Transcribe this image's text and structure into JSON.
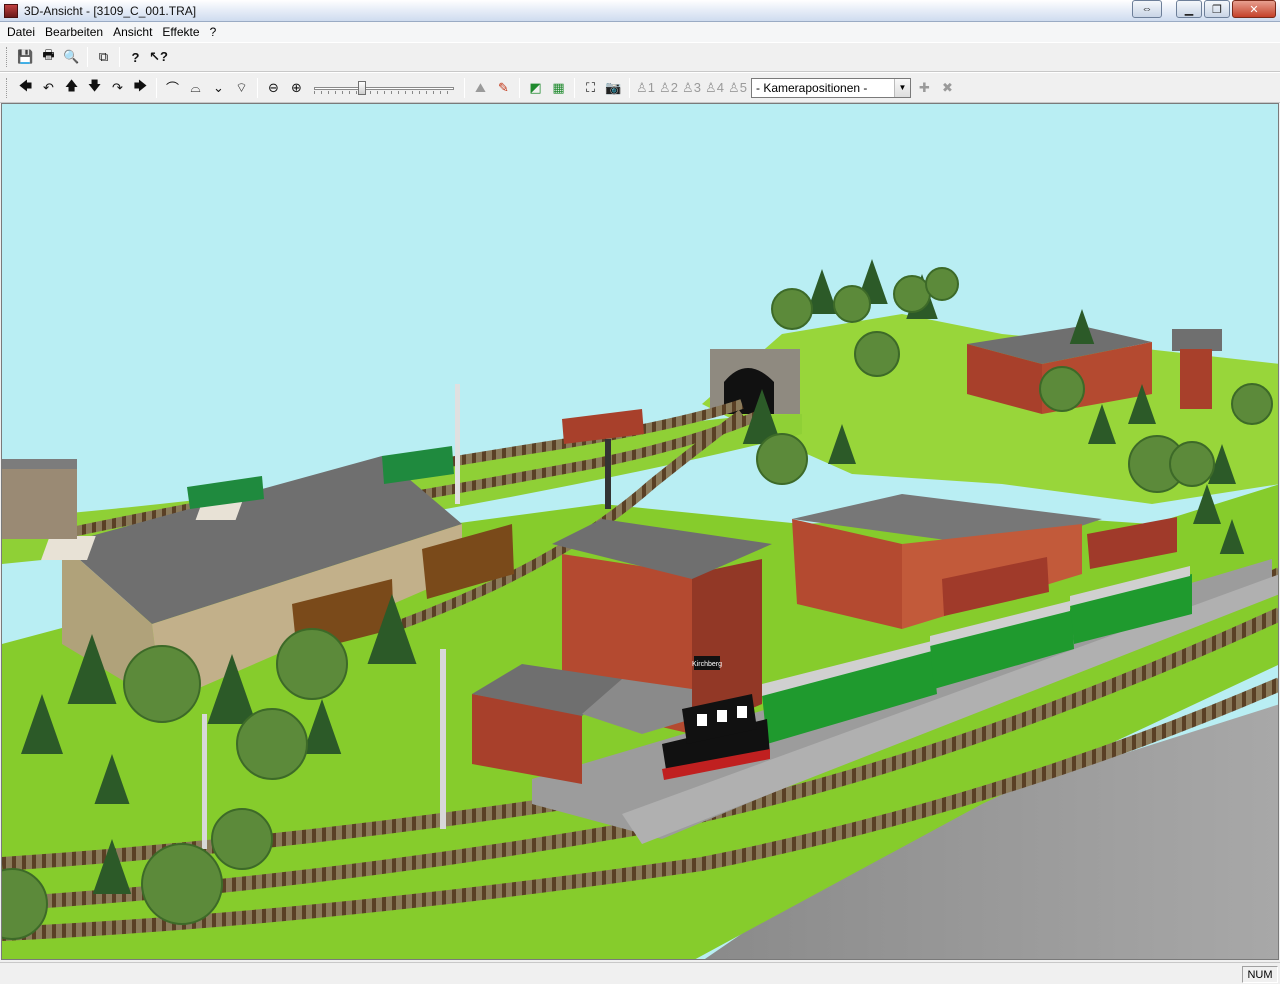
{
  "window": {
    "title": "3D-Ansicht - [3109_C_001.TRA]"
  },
  "menu": {
    "items": [
      "Datei",
      "Bearbeiten",
      "Ansicht",
      "Effekte",
      "?"
    ]
  },
  "toolbar2": {
    "camera_combo_value": "- Kamerapositionen -",
    "zoom_slider_fraction": 0.33
  },
  "scene": {
    "station_sign": "Kirchberg"
  },
  "status": {
    "num_indicator": "NUM"
  },
  "colors": {
    "sky": "#b9eef3",
    "grass": "#86cc2c",
    "brick": "#a8402b",
    "coach_green": "#1f9a2e",
    "roof_grey": "#6f6f6f"
  }
}
